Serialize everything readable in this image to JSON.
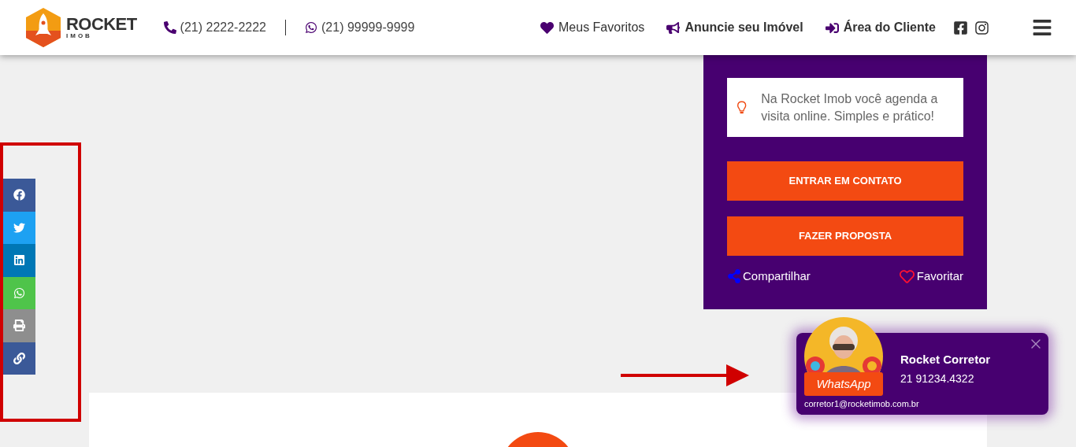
{
  "header": {
    "logo": {
      "name": "ROCKET",
      "sub": "IMOB"
    },
    "phones": [
      {
        "kind": "phone",
        "number": "(21) 2222-2222"
      },
      {
        "kind": "whatsapp",
        "number": "(21) 99999-9999"
      }
    ],
    "nav": [
      {
        "kind": "heart",
        "label": "Meus Favoritos",
        "bold": false
      },
      {
        "kind": "megaphone",
        "label": "Anuncie seu Imóvel",
        "bold": true
      },
      {
        "kind": "login",
        "label": "Área do Cliente",
        "bold": true
      }
    ],
    "social": [
      {
        "kind": "facebook"
      },
      {
        "kind": "instagram"
      }
    ]
  },
  "share_bar": [
    {
      "kind": "facebook"
    },
    {
      "kind": "twitter"
    },
    {
      "kind": "linkedin"
    },
    {
      "kind": "whatsapp"
    },
    {
      "kind": "print"
    },
    {
      "kind": "link"
    }
  ],
  "contact_panel": {
    "tip": "Na Rocket Imob você agenda a visita online. Simples e prático!",
    "buttons": [
      "ENTRAR EM CONTATO",
      "FAZER PROPOSTA"
    ],
    "share_label": "Compartilhar",
    "favorite_label": "Favoritar"
  },
  "agent_popup": {
    "name": "Rocket Corretor",
    "phone": "21 91234.4322",
    "whatsapp_label": "WhatsApp",
    "email": "corretor1@rocketimob.com.br"
  }
}
